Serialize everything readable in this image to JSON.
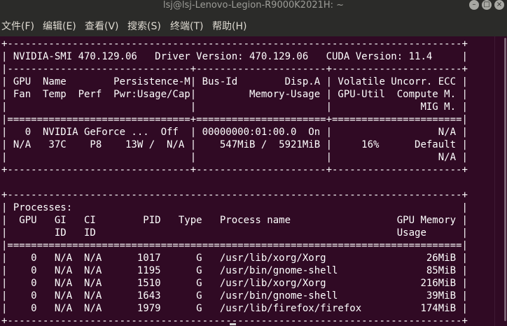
{
  "window": {
    "title": "lsj@lsj-Lenovo-Legion-R9000K2021H: ~",
    "buttons": {
      "minimize": "–",
      "maximize": "□",
      "close": "×"
    }
  },
  "menubar": {
    "items": [
      "文件(F)",
      "编辑(E)",
      "查看(V)",
      "搜索(S)",
      "终端(T)",
      "帮助(H)"
    ]
  },
  "terminal": {
    "lines": [
      "+-----------------------------------------------------------------------------+",
      "| NVIDIA-SMI 470.129.06   Driver Version: 470.129.06   CUDA Version: 11.4     |",
      "|-------------------------------+----------------------+----------------------+",
      "| GPU  Name        Persistence-M| Bus-Id        Disp.A | Volatile Uncorr. ECC |",
      "| Fan  Temp  Perf  Pwr:Usage/Cap|         Memory-Usage | GPU-Util  Compute M. |",
      "|                               |                      |               MIG M. |",
      "|===============================+======================+======================|",
      "|   0  NVIDIA GeForce ...  Off  | 00000000:01:00.0  On |                  N/A |",
      "| N/A   37C    P8    13W /  N/A |    547MiB /  5921MiB |     16%      Default |",
      "|                               |                      |                  N/A |",
      "+-------------------------------+----------------------+----------------------+",
      "",
      "+-----------------------------------------------------------------------------+",
      "| Processes:                                                                  |",
      "|  GPU   GI   CI        PID   Type   Process name                  GPU Memory |",
      "|        ID   ID                                                   Usage      |",
      "|=============================================================================|",
      "|    0   N/A  N/A      1017      G   /usr/lib/xorg/Xorg                 26MiB |",
      "|    0   N/A  N/A      1195      G   /usr/bin/gnome-shell               85MiB |",
      "|    0   N/A  N/A      1510      G   /usr/lib/xorg/Xorg                216MiB |",
      "|    0   N/A  N/A      1643      G   /usr/bin/gnome-shell               39MiB |",
      "|    0   N/A  N/A      1979      G   /usr/lib/firefox/firefox          174MiB |",
      "+-----------------------------------------------------------------------------+"
    ]
  },
  "colors": {
    "terminal_background": "#300a24",
    "text": "#ffffff",
    "chrome": "#2b2b29",
    "menu_text": "#dfdbd2"
  }
}
